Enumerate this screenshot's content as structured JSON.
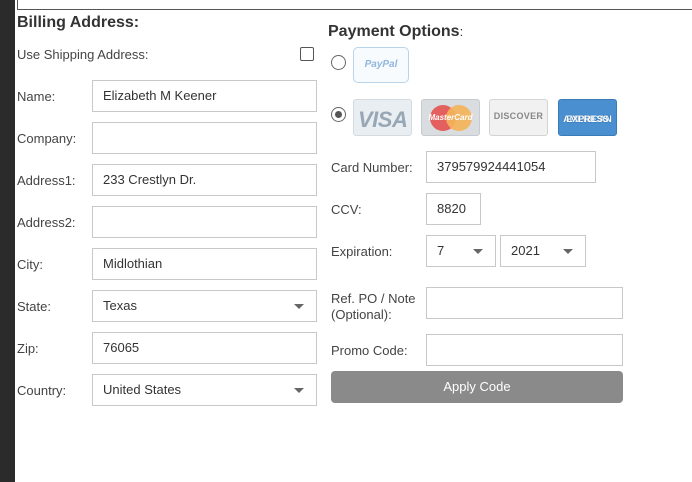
{
  "billing": {
    "title": "Billing Address:",
    "use_shipping_label": "Use Shipping Address:",
    "use_shipping_checked": false,
    "fields": {
      "name": {
        "label": "Name:",
        "value": "Elizabeth M Keener"
      },
      "company": {
        "label": "Company:",
        "value": ""
      },
      "address1": {
        "label": "Address1:",
        "value": "233 Crestlyn Dr."
      },
      "address2": {
        "label": "Address2:",
        "value": ""
      },
      "city": {
        "label": "City:",
        "value": "Midlothian"
      },
      "state": {
        "label": "State:",
        "value": "Texas"
      },
      "zip": {
        "label": "Zip:",
        "value": "76065"
      },
      "country": {
        "label": "Country:",
        "value": "United States"
      }
    }
  },
  "payment": {
    "title": "Payment Options",
    "title_suffix": ":",
    "options": [
      {
        "id": "paypal",
        "logo_text": "PayPal",
        "selected": false
      },
      {
        "id": "credit-card",
        "selected": true,
        "card_logos": {
          "visa": "VISA",
          "mastercard": "MasterCard",
          "discover": "DISCOVER",
          "amex_line1": "AMERICAN",
          "amex_line2": "EXPRESS"
        }
      }
    ],
    "card_number": {
      "label": "Card Number:",
      "value": "379579924441054"
    },
    "ccv": {
      "label": "CCV:",
      "value": "8820"
    },
    "expiration": {
      "label": "Expiration:",
      "month": "7",
      "year": "2021"
    },
    "ref_po": {
      "label_line1": "Ref. PO / Note",
      "label_line2": "(Optional):",
      "value": ""
    },
    "promo": {
      "label": "Promo Code:",
      "value": ""
    },
    "apply_button": "Apply Code"
  },
  "colors": {
    "sidebar": "#2b2b2b",
    "button_bg": "#8a8a8a",
    "field_border": "#c8c8c8",
    "amex_blue": "#4a8fd0"
  },
  "icons": [
    "checkbox-icon",
    "radio-icon",
    "dropdown-caret-icon",
    "paypal-logo",
    "visa-logo",
    "mastercard-logo",
    "discover-logo",
    "amex-logo"
  ]
}
